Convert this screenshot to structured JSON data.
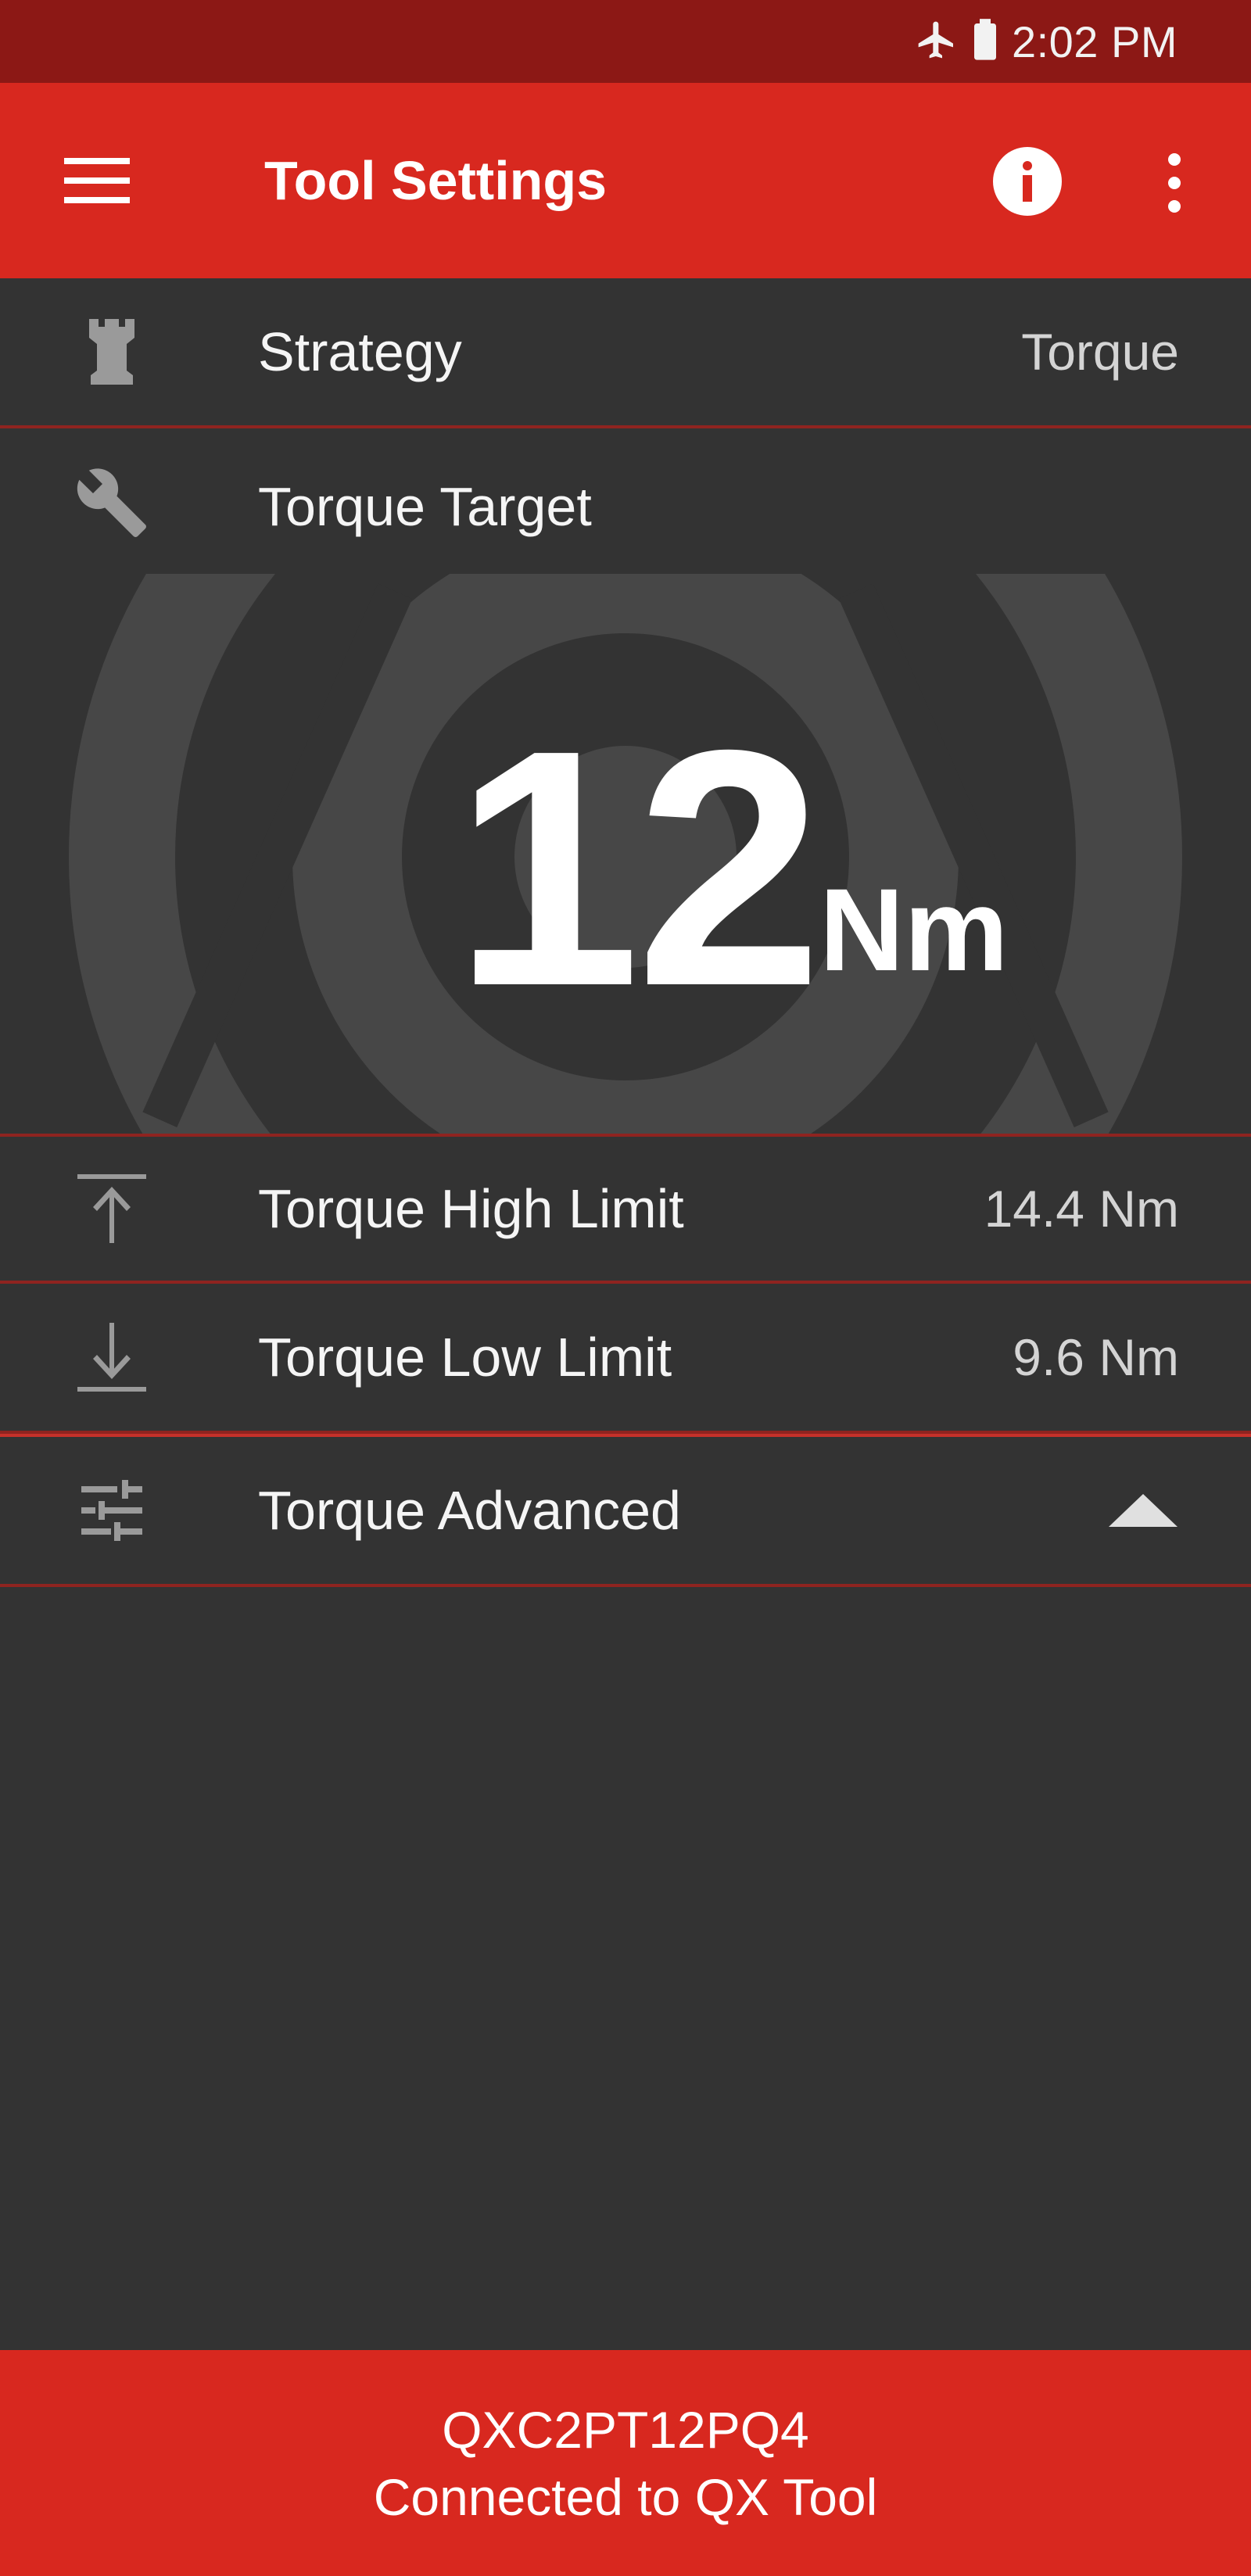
{
  "status_bar": {
    "time": "2:02 PM",
    "icons": [
      "airplane-mode-icon",
      "battery-icon"
    ]
  },
  "app_bar": {
    "title": "Tool Settings",
    "icons": [
      "menu-icon",
      "info-icon",
      "more-vert-icon"
    ]
  },
  "settings": {
    "strategy": {
      "label": "Strategy",
      "value": "Torque",
      "icon": "chess-rook-icon"
    },
    "torque_target": {
      "label": "Torque Target",
      "value": "12",
      "unit": "Nm",
      "icon": "wrench-icon"
    },
    "torque_high": {
      "label": "Torque High Limit",
      "value": "14.4 Nm",
      "icon": "arrow-up-to-line-icon"
    },
    "torque_low": {
      "label": "Torque Low Limit",
      "value": "9.6 Nm",
      "icon": "arrow-down-to-line-icon"
    },
    "torque_advanced": {
      "label": "Torque Advanced",
      "icon": "tune-sliders-icon",
      "state_icon": "triangle-up-icon"
    }
  },
  "footer": {
    "serial": "QXC2PT12PQ4",
    "connection": "Connected to QX Tool"
  },
  "colors": {
    "status_bar": "#8c1815",
    "app_bar": "#d8281f",
    "background": "#333333",
    "divider": "#8f2420",
    "ring": "#474747",
    "icon_grey": "#9a9a9a"
  }
}
